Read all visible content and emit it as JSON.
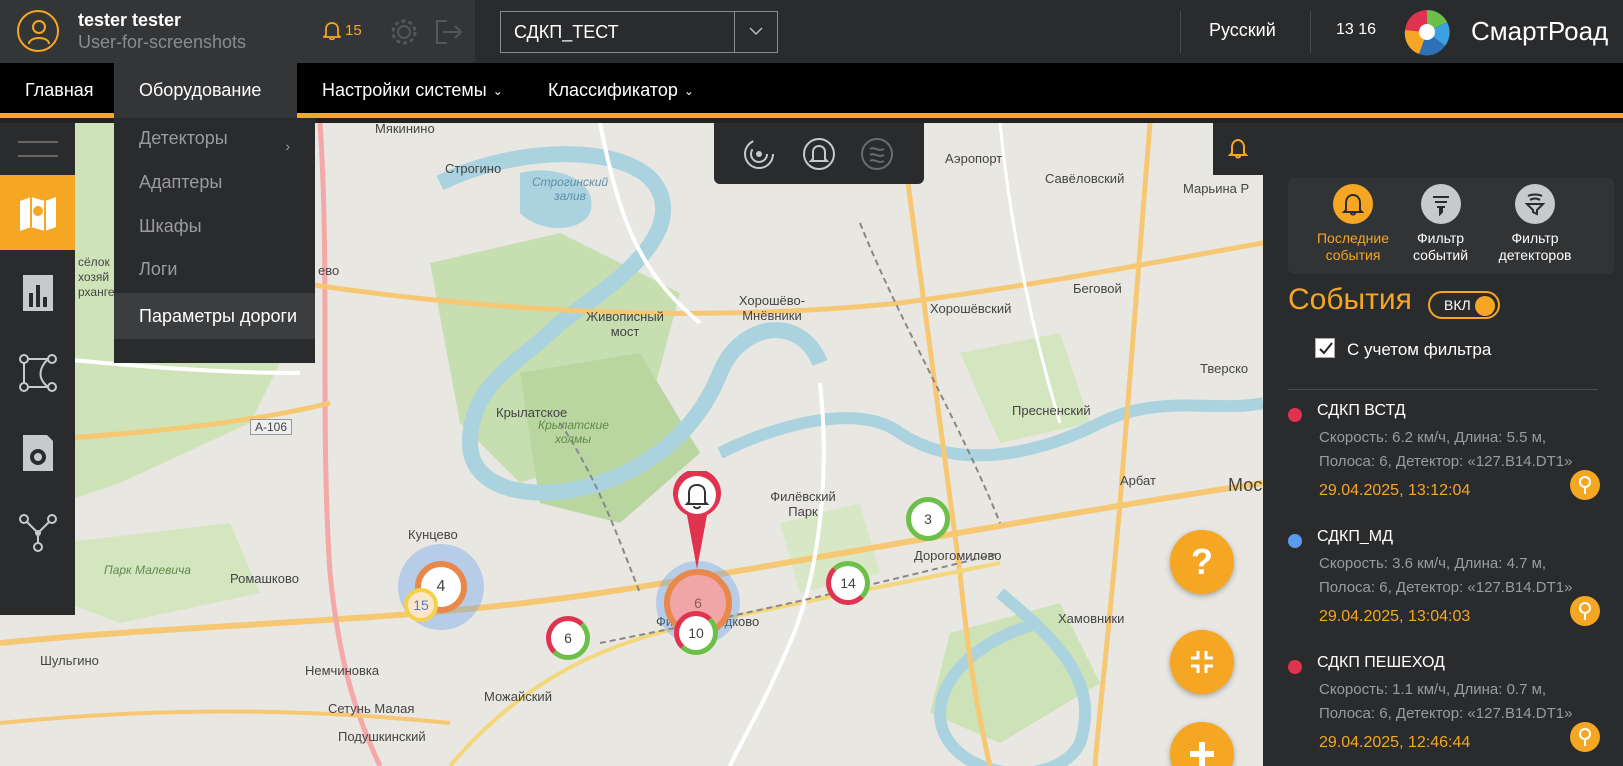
{
  "header": {
    "user_name": "tester tester",
    "user_login": "User-for-screenshots",
    "notifications_count": "15",
    "project_select_value": "СДКП_ТЕСТ",
    "language": "Русский",
    "time": "13 16",
    "brand": "СмартРоад"
  },
  "menu": {
    "items": [
      {
        "label": "Главная"
      },
      {
        "label": "Оборудование"
      },
      {
        "label": "Настройки системы"
      },
      {
        "label": "Классификатор"
      }
    ]
  },
  "submenu": {
    "items": [
      {
        "label": "Детекторы"
      },
      {
        "label": "Адаптеры"
      },
      {
        "label": "Шкафы"
      },
      {
        "label": "Логи"
      },
      {
        "label": "Параметры дороги"
      }
    ]
  },
  "map": {
    "labels": [
      "Мякинино",
      "Строгино",
      "Строгинский залив",
      "Аэропорт",
      "Савёловский",
      "Марьина Р",
      "Хорошёво-Мнёвники",
      "Хорошёвский",
      "Беговой",
      "Живописный мост",
      "Крылатское",
      "Крылатские холмы",
      "Пресненский",
      "Тверско",
      "Арбат",
      "Мос",
      "Филёвский Парк",
      "Дорогомилово",
      "Кунцево",
      "Парк Малевича",
      "Ромашково",
      "Хамовники",
      "Шульгино",
      "Немчиновка",
      "Можайский",
      "Сетунь Малая",
      "Подушкинский",
      "Фили-Давыдково",
      "А-106",
      "сёлок хозяй рханге",
      "ево"
    ],
    "clusters": [
      {
        "count": "4"
      },
      {
        "count": "15"
      },
      {
        "count": "6"
      },
      {
        "count": "6"
      },
      {
        "count": "10"
      },
      {
        "count": "14"
      },
      {
        "count": "3"
      }
    ],
    "fab_help": "?"
  },
  "panel": {
    "tabs": [
      {
        "label": "Последние события"
      },
      {
        "label": "Фильтр событий"
      },
      {
        "label": "Фильтр детекторов"
      }
    ],
    "events_title": "События",
    "toggle_label": "ВКЛ",
    "filter_label": "С учетом фильтра",
    "events": [
      {
        "title": "СДКП ВСТД",
        "line1": "Скорость: 6.2 км/ч, Длина: 5.5 м,",
        "line2": "Полоса: 6, Детектор: «127.B14.DT1»",
        "time": "29.04.2025, 13:12:04",
        "color": "#e0334f"
      },
      {
        "title": "СДКП_МД",
        "line1": "Скорость: 3.6 км/ч, Длина: 4.7 м,",
        "line2": "Полоса: 6, Детектор: «127.B14.DT1»",
        "time": "29.04.2025, 13:04:03",
        "color": "#5b9bef"
      },
      {
        "title": "СДКП ПЕШЕХОД",
        "line1": "Скорость: 1.1 км/ч, Длина: 0.7 м,",
        "line2": "Полоса: 6, Детектор: «127.B14.DT1»",
        "time": "29.04.2025, 12:46:44",
        "color": "#e0334f"
      }
    ]
  },
  "colors": {
    "accent": "#f5a623",
    "dark": "#2a2b2d",
    "alert_red": "#e0334f",
    "ok_green": "#6cc04a"
  }
}
